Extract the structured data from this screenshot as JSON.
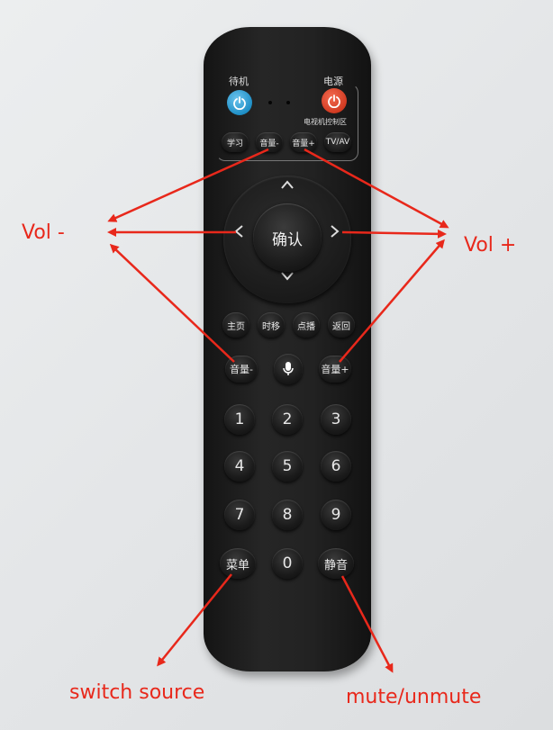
{
  "remote": {
    "standby_label": "待机",
    "power_label": "电源",
    "tv_zone_label": "电视机控制区",
    "tv_row": [
      "学习",
      "音量-",
      "音量+",
      "TV/AV"
    ],
    "ok_label": "确认",
    "func_row": [
      "主页",
      "时移",
      "点播",
      "返回"
    ],
    "vol_minus": "音量-",
    "vol_plus": "音量+",
    "digits": [
      "1",
      "2",
      "3",
      "4",
      "5",
      "6",
      "7",
      "8",
      "9"
    ],
    "menu_label": "菜单",
    "zero_label": "0",
    "mute_label": "静音"
  },
  "annotations": {
    "vol_minus": "Vol -",
    "vol_plus": "Vol +",
    "switch_source": "switch source",
    "mute_unmute": "mute/unmute",
    "arrow_color": "#e8281b"
  },
  "icons": {
    "power": "power-icon",
    "mic": "microphone-icon",
    "up": "arrow-up-icon",
    "down": "arrow-down-icon",
    "left": "arrow-left-icon",
    "right": "arrow-right-icon"
  }
}
